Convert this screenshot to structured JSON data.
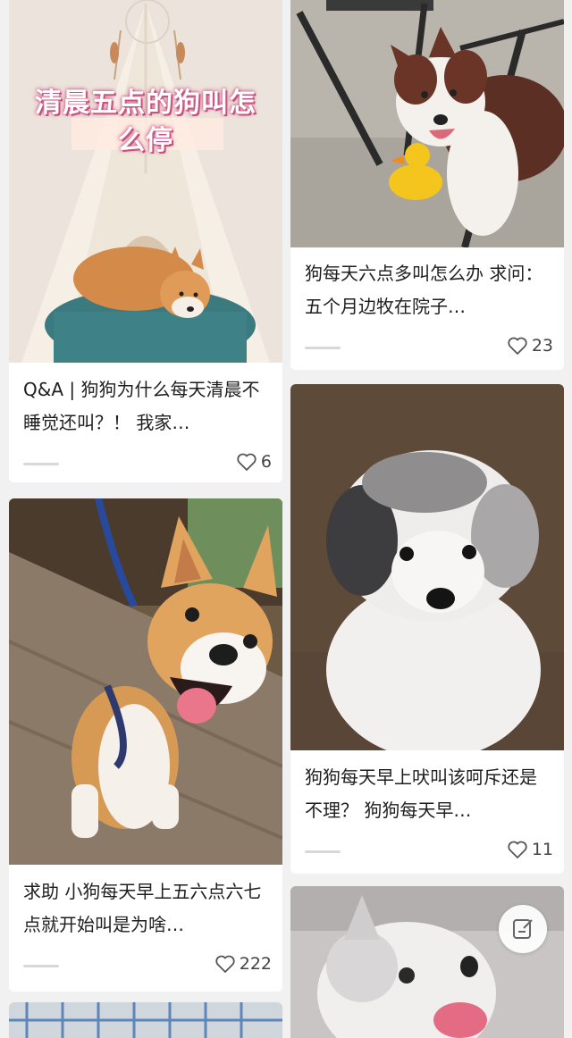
{
  "cards": [
    {
      "cover_text_line1": "清晨五点的狗叫怎",
      "cover_text_line2": "么停",
      "title": "Q&A | 狗狗为什么每天清晨不睡觉还叫？！ 我家…",
      "likes": "6",
      "image": "shiba-in-tent"
    },
    {
      "title": "狗每天六点多叫怎么办 求问：五个月边牧在院子…",
      "likes": "23",
      "image": "border-collie-with-duck"
    },
    {
      "title": "求助 小狗每天早上五六点六七点就开始叫是为啥…",
      "likes": "222",
      "image": "corgi-puppy"
    },
    {
      "title": "狗狗每天早上吠叫该呵斥还是不理？ 狗狗每天早…",
      "likes": "11",
      "image": "poodle-puppy"
    },
    {
      "image": "husky-puppy"
    },
    {
      "image": "cage"
    }
  ],
  "icons": {
    "like": "heart-icon",
    "compose": "edit-icon"
  },
  "colors": {
    "background": "#f1f1f1",
    "card": "#ffffff",
    "text": "#1e1e1e",
    "cover_text_glow": "#c54d7a"
  }
}
